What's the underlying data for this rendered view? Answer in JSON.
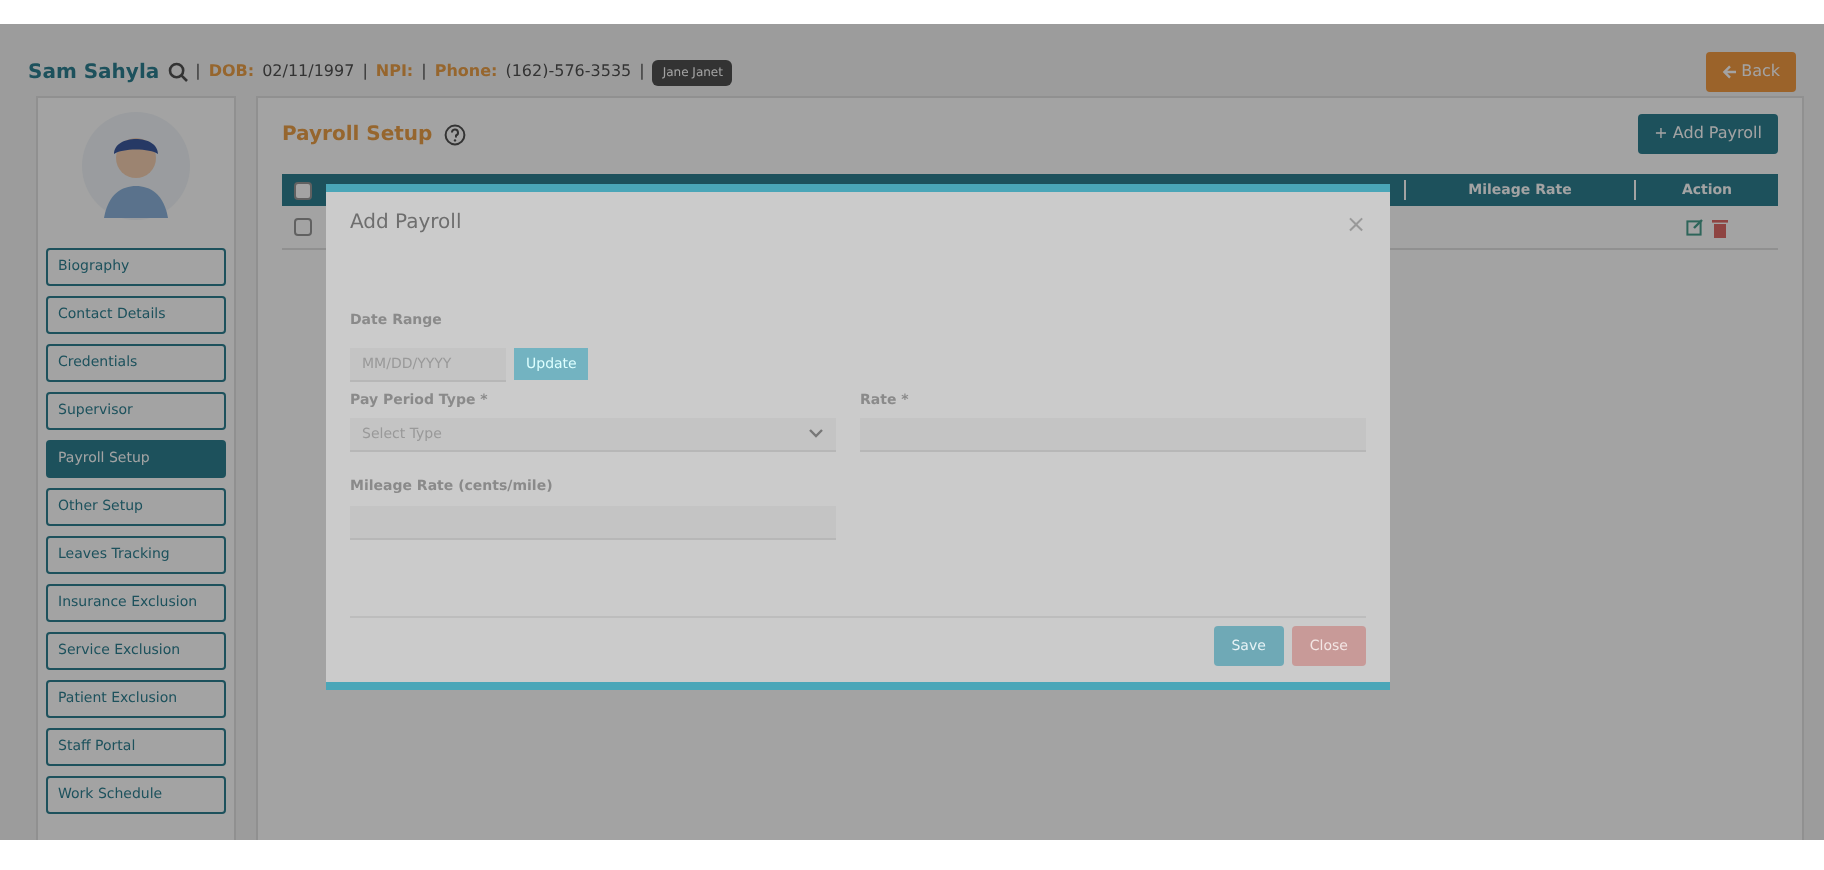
{
  "header": {
    "name": "Sam Sahyla",
    "separator": "|",
    "fields": [
      {
        "label": "DOB:",
        "value": "02/11/1997"
      },
      {
        "label": "NPI:"
      },
      {
        "label": "Phone:",
        "value": "(162)-576-3535"
      }
    ],
    "badge": "Jane Janet",
    "back_button": "Back"
  },
  "sidebar": {
    "items": [
      {
        "label": "Biography",
        "selected": false
      },
      {
        "label": "Contact Details",
        "selected": false
      },
      {
        "label": "Credentials",
        "selected": false
      },
      {
        "label": "Supervisor",
        "selected": false
      },
      {
        "label": "Payroll Setup",
        "selected": true
      },
      {
        "label": "Other Setup",
        "selected": false
      },
      {
        "label": "Leaves Tracking",
        "selected": false
      },
      {
        "label": "Insurance Exclusion",
        "selected": false
      },
      {
        "label": "Service Exclusion",
        "selected": false
      },
      {
        "label": "Patient Exclusion",
        "selected": false
      },
      {
        "label": "Staff Portal",
        "selected": false
      },
      {
        "label": "Work Schedule",
        "selected": false
      }
    ]
  },
  "main": {
    "title": "Payroll Setup",
    "add_button": "+ Add Payroll"
  },
  "table": {
    "select_all": {
      "checked": false
    },
    "columns": [
      {
        "label": "Mileage Rate"
      },
      {
        "label": "Action"
      }
    ],
    "rows": [
      {
        "checked": false
      }
    ]
  },
  "modal": {
    "title": "Add Payroll",
    "close": "×",
    "date_label": "Date Range",
    "date_placeholder": "MM/DD/YYYY",
    "update_button": "Update",
    "pay_period_label": "Pay Period Type *",
    "pay_period_placeholder": "Select Type",
    "rate_label": "Rate *",
    "mileage_label": "Mileage Rate (cents/mile)",
    "save_button": "Save",
    "close_button": "Close"
  }
}
